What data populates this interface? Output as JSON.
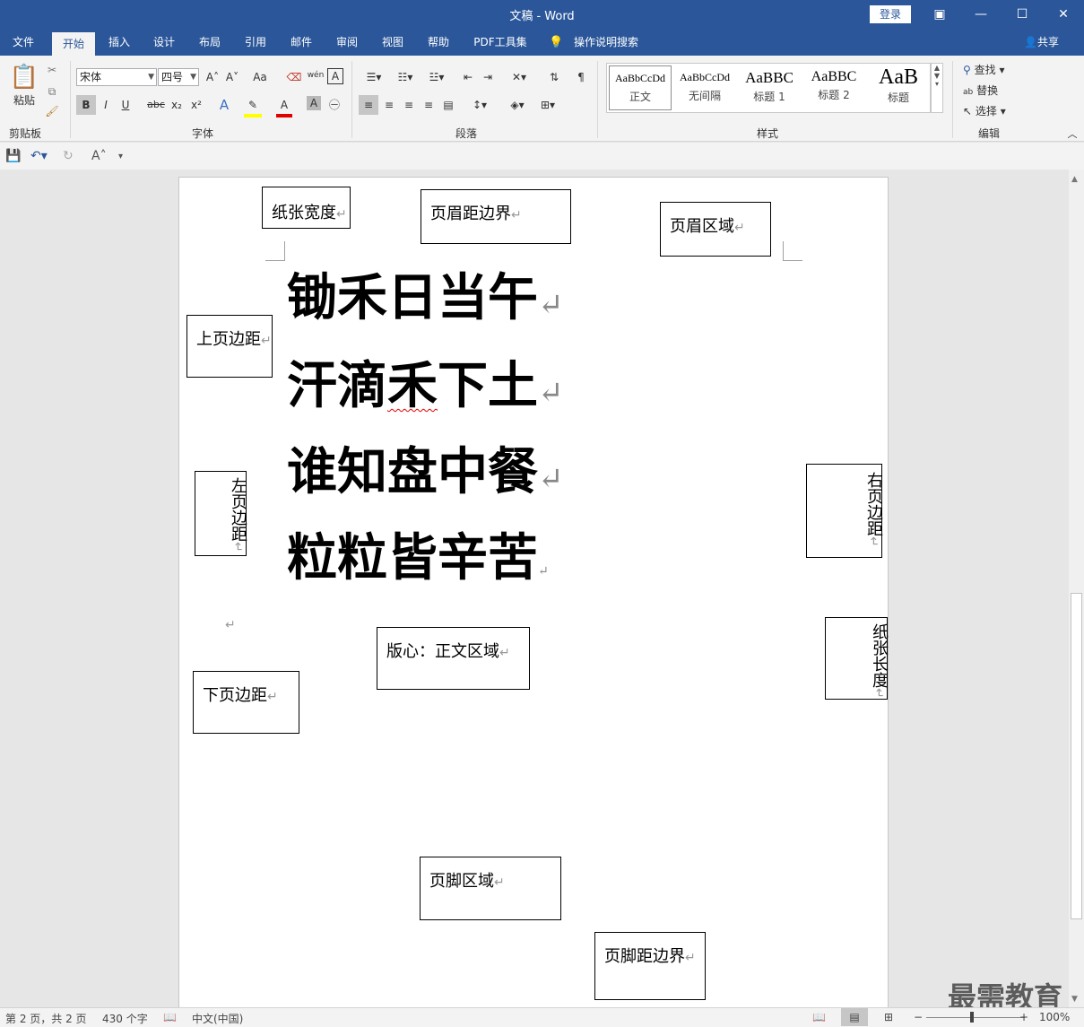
{
  "window": {
    "title": "文稿 - Word",
    "login_label": "登录",
    "controls": [
      "▣",
      "—",
      "☐",
      "✕"
    ]
  },
  "menu": {
    "tabs": [
      "文件",
      "开始",
      "插入",
      "设计",
      "布局",
      "引用",
      "邮件",
      "审阅",
      "视图",
      "帮助",
      "PDF工具集"
    ],
    "active": "开始",
    "tell_me": "操作说明搜索",
    "share": "共享"
  },
  "ribbon": {
    "clipboard": {
      "paste_label": "粘贴",
      "group_label": "剪贴板"
    },
    "font": {
      "font_name": "宋体",
      "font_size": "四号",
      "group_label": "字体",
      "bold": "B",
      "italic": "I",
      "underline": "U",
      "strike": "abc",
      "sub": "x₂",
      "sup": "x²",
      "grow": "A˄",
      "shrink": "A˅",
      "case": "Aa",
      "phonetic": "wén",
      "border": "A"
    },
    "paragraph": {
      "group_label": "段落"
    },
    "styles": {
      "group_label": "样式",
      "items": [
        {
          "preview": "AaBbCcDd",
          "name": "正文"
        },
        {
          "preview": "AaBbCcDd",
          "name": "无间隔"
        },
        {
          "preview": "AaBBC",
          "name": "标题 1"
        },
        {
          "preview": "AaBBC",
          "name": "标题 2"
        },
        {
          "preview": "AaB",
          "name": "标题"
        }
      ]
    },
    "editing": {
      "group_label": "编辑",
      "find": "查找",
      "replace": "替换",
      "select": "选择"
    }
  },
  "document": {
    "poem_lines": [
      "锄禾日当午",
      "汗滴禾下土",
      "谁知盘中餐",
      "粒粒皆辛苦"
    ],
    "misspelled": "禾",
    "labels": {
      "paper_width": "纸张宽度",
      "header_distance": "页眉距边界",
      "header_area": "页眉区域",
      "top_margin": "上页边距",
      "left_margin": "左页边距",
      "right_margin": "右页边距",
      "paper_length": "纸张长度",
      "body_area": "版心：正文区域",
      "bottom_margin": "下页边距",
      "footer_area": "页脚区域",
      "footer_distance": "页脚距边界"
    },
    "para_mark": "↵"
  },
  "status": {
    "page": "第 2 页，共 2 页",
    "words": "430 个字",
    "language": "中文(中国)",
    "zoom": "100%"
  },
  "watermark": "最需教育"
}
